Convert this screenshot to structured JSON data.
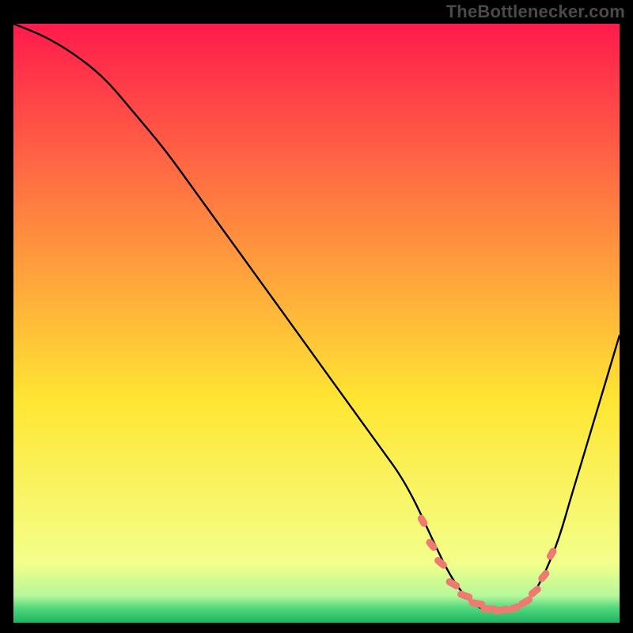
{
  "attribution": "TheBottlenecker.com",
  "chart_data": {
    "type": "line",
    "title": "",
    "xlabel": "",
    "ylabel": "",
    "xlim": [
      0,
      100
    ],
    "ylim": [
      0,
      100
    ],
    "background_gradient": {
      "top": "#ff1a4c",
      "mid": "#ffe633",
      "bottom": "#1cb45f"
    },
    "curve_note": "V-shaped bottleneck curve; sweet spot band near x≈70–86",
    "series": [
      {
        "name": "bottleneck-curve",
        "x": [
          0,
          5,
          10,
          15,
          20,
          25,
          30,
          35,
          40,
          45,
          50,
          55,
          60,
          65,
          70,
          72,
          74,
          76,
          78,
          80,
          82,
          84,
          86,
          88,
          90,
          92,
          95,
          100
        ],
        "y": [
          100,
          98,
          95,
          91,
          85,
          79,
          72,
          65,
          58,
          51,
          44,
          37,
          30,
          23,
          12,
          8,
          5,
          3,
          2,
          2,
          2,
          3,
          5,
          9,
          14,
          21,
          31,
          48
        ]
      }
    ],
    "sweet_spot_markers_note": "Salmon capsule markers along the curve bottom",
    "sweet_spot_markers": [
      {
        "x": 67.5,
        "y": 17
      },
      {
        "x": 69.0,
        "y": 13
      },
      {
        "x": 70.5,
        "y": 10
      },
      {
        "x": 72.5,
        "y": 6.5
      },
      {
        "x": 74.5,
        "y": 4.5
      },
      {
        "x": 76.5,
        "y": 3.2
      },
      {
        "x": 78.5,
        "y": 2.3
      },
      {
        "x": 80.5,
        "y": 2.1
      },
      {
        "x": 82.5,
        "y": 2.4
      },
      {
        "x": 84.5,
        "y": 3.5
      },
      {
        "x": 86.0,
        "y": 5.2
      },
      {
        "x": 87.5,
        "y": 7.8
      },
      {
        "x": 88.8,
        "y": 11.5
      }
    ],
    "colors": {
      "curve": "#000000",
      "marker": "#ee7b72"
    }
  }
}
